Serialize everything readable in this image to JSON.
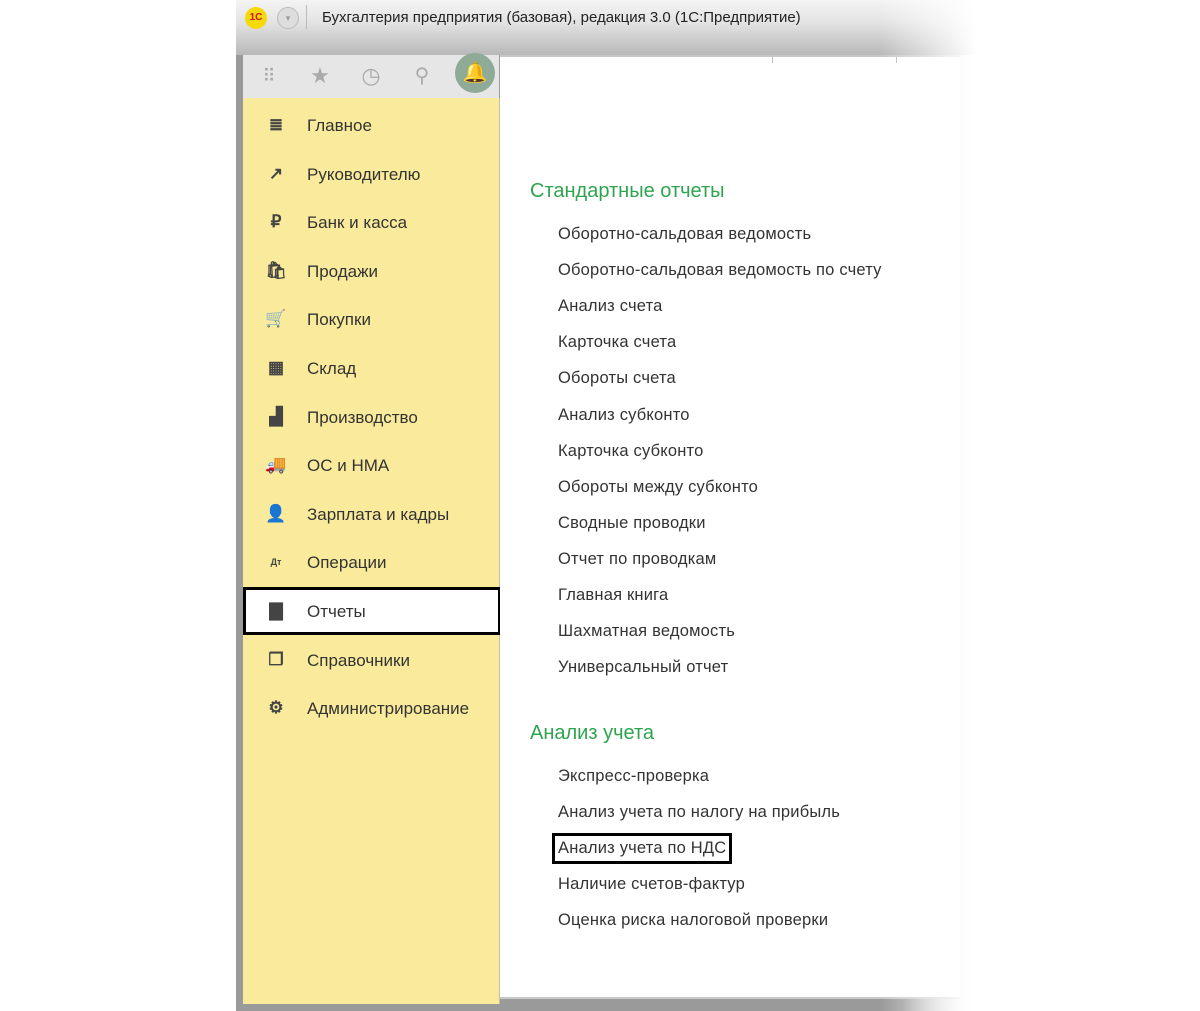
{
  "window": {
    "title": "Бухгалтерия предприятия (базовая), редакция 3.0  (1С:Предприятие)",
    "logo": "1С"
  },
  "toolbar": {
    "icons": [
      "apps-grid-icon",
      "favorites-star-icon",
      "history-icon",
      "search-icon",
      "notifications-bell-icon"
    ]
  },
  "sidebar": {
    "items": [
      {
        "label": "Главное",
        "icon": "≣"
      },
      {
        "label": "Руководителю",
        "icon": "↗"
      },
      {
        "label": "Банк и касса",
        "icon": "₽"
      },
      {
        "label": "Продажи",
        "icon": "🛍"
      },
      {
        "label": "Покупки",
        "icon": "🛒"
      },
      {
        "label": "Склад",
        "icon": "▦"
      },
      {
        "label": "Производство",
        "icon": "▟"
      },
      {
        "label": "ОС и НМА",
        "icon": "🚚"
      },
      {
        "label": "Зарплата и кадры",
        "icon": "👤"
      },
      {
        "label": "Операции",
        "icon": "Дт"
      },
      {
        "label": "Отчеты",
        "icon": "▇"
      },
      {
        "label": "Справочники",
        "icon": "❐"
      },
      {
        "label": "Администрирование",
        "icon": "⚙"
      }
    ],
    "active": "Отчеты"
  },
  "sections": [
    {
      "title": "Стандартные отчеты",
      "items": [
        "Оборотно-сальдовая ведомость",
        "Оборотно-сальдовая ведомость по счету",
        "Анализ счета",
        "Карточка счета",
        "Обороты счета",
        "Анализ субконто",
        "Карточка субконто",
        "Обороты между субконто",
        "Сводные проводки",
        "Отчет по проводкам",
        "Главная книга",
        "Шахматная ведомость",
        "Универсальный отчет"
      ]
    },
    {
      "title": "Анализ учета",
      "items": [
        "Экспресс-проверка",
        "Анализ учета по налогу на прибыль",
        "Анализ учета по НДС",
        "Наличие счетов-фактур",
        "Оценка риска налоговой проверки"
      ]
    }
  ],
  "highlighted_item": "Анализ учета по НДС",
  "colors": {
    "sidebar": "#faeb9c",
    "section_heading": "#2ea44f"
  }
}
